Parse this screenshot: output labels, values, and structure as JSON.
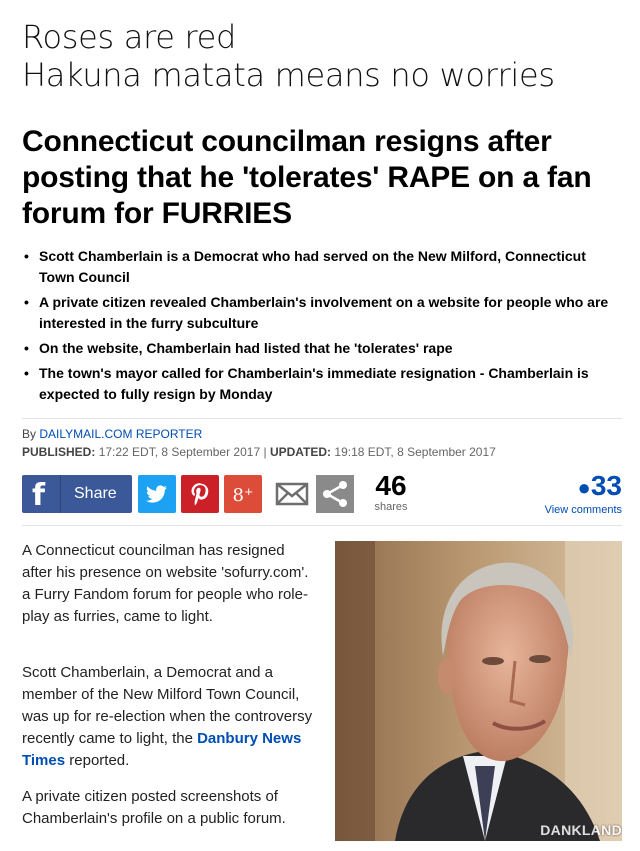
{
  "meme_caption": {
    "line1": "Roses are red",
    "line2": "Hakuna matata means no worries"
  },
  "article": {
    "headline": "Connecticut councilman resigns after posting that he 'tolerates' RAPE on a fan forum for FURRIES",
    "bullets": [
      "Scott Chamberlain is a Democrat who had served on the New Milford, Connecticut Town Council",
      "A private citizen revealed Chamberlain's involvement on a website for people who are interested in the furry subculture",
      "On the website, Chamberlain had listed that he 'tolerates' rape",
      "The town's mayor called for Chamberlain's immediate resignation - Chamberlain is expected to fully resign by Monday"
    ],
    "byline": {
      "prefix": "By",
      "author": "DAILYMAIL.COM REPORTER"
    },
    "published": {
      "published_label": "PUBLISHED:",
      "published_value": "17:22 EDT, 8 September 2017",
      "separator": "|",
      "updated_label": "UPDATED:",
      "updated_value": "19:18 EDT, 8 September 2017"
    },
    "share": {
      "share_label": "Share",
      "share_count": "46",
      "share_count_label": "shares",
      "comment_count": "33",
      "comment_label": "View comments",
      "icons": [
        "facebook-icon",
        "twitter-icon",
        "pinterest-icon",
        "google-plus-icon",
        "email-icon",
        "share-icon"
      ],
      "colors": {
        "facebook": "#3b5998",
        "twitter": "#1da1f2",
        "pinterest": "#cb2027",
        "google_plus": "#dd4b39",
        "link": "#004db3"
      }
    },
    "body": {
      "p1": "A Connecticut councilman has resigned after his presence on website 'sofurry.com'. a Furry Fandom forum for people who role-play as furries, came to light.",
      "p2_before": "Scott Chamberlain, a Democrat and a member of the New Milford Town Council, was up for re-election when the controversy recently came to light, the ",
      "p2_link": "Danbury News Times",
      "p2_after": " reported.",
      "p3": "A private citizen posted screenshots of Chamberlain's profile on a public forum."
    },
    "photo": {
      "watermark": "DANKLAND"
    }
  }
}
